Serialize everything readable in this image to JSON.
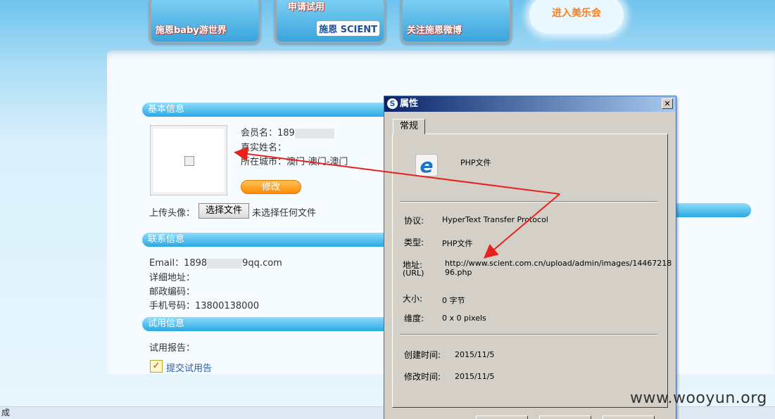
{
  "banner": {
    "tile1_text": "施恩baby游世界",
    "tile2_text": "申请试用",
    "tile2_brand": "施恩 SCIENT",
    "tile3_text": "关注施恩微博",
    "cloud_text": "进入美乐会"
  },
  "basic_info": {
    "section_title": "基本信息",
    "member_label": "会员名：189",
    "realname_label": "真实姓名：",
    "city_label": "所在城市：澳门-澳门-澳门",
    "edit_button": "修改",
    "upload_label": "上传头像：",
    "file_button": "选择文件",
    "file_status": "未选择任何文件"
  },
  "contact_info": {
    "section_title": "联系信息",
    "email_prefix": "Email：1898",
    "email_suffix": "9qq.com",
    "address_label": "详细地址：",
    "postcode_label": "邮政编码：",
    "mobile_label": "手机号码：13800138000"
  },
  "trial_info": {
    "section_title": "试用信息",
    "report_label": "试用报告：",
    "submit_link": "提交试用告"
  },
  "statusbar": {
    "text": "成"
  },
  "dialog": {
    "title": "属性",
    "tab_general": "常规",
    "file_type_title": "PHP文件",
    "protocol_label": "协议:",
    "protocol_value": "HyperText Transfer Protocol",
    "type_label": "类型:",
    "type_value": "PHP文件",
    "address_label": "地址:",
    "address_sub": "(URL)",
    "address_value_line1": "http://www.scient.com.cn/upload/admin/images/14467218",
    "address_value_line2": "96.php",
    "size_label": "大小:",
    "size_value": "0 字节",
    "dimension_label": "维度:",
    "dimension_value": "0  x  0  pixels",
    "created_label": "创建时间:",
    "created_value": "2015/11/5",
    "modified_label": "修改时间:",
    "modified_value": "2015/11/5"
  },
  "watermark": "www.wooyun.org",
  "colors": {
    "section_bar": "#2aa8e3",
    "edit_button": "#ff8a00",
    "annotation_arrow": "#e8211d",
    "dialog_title": "#0a246a"
  }
}
